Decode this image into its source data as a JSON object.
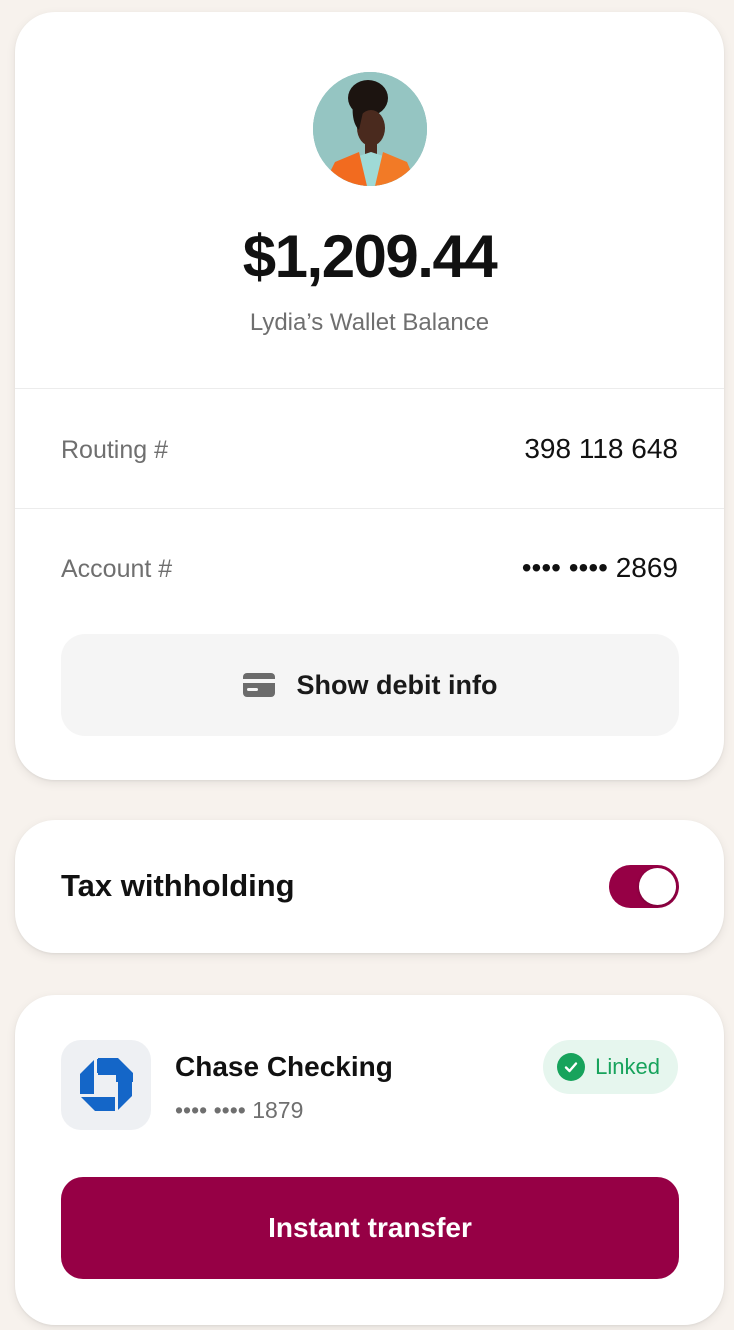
{
  "wallet": {
    "balance": "$1,209.44",
    "balance_label": "Lydia’s Wallet Balance",
    "routing_label": "Routing #",
    "routing_value": "398 118 648",
    "account_label": "Account #",
    "account_value": "•••• •••• 2869",
    "show_debit_label": "Show debit info",
    "show_debit_icon": "credit-card-icon"
  },
  "tax": {
    "label": "Tax withholding",
    "toggle_on": true
  },
  "bank": {
    "logo_icon": "chase-logo-icon",
    "name": "Chase Checking",
    "account": "•••• •••• 1879",
    "status_label": "Linked",
    "status_icon": "check-circle-icon"
  },
  "actions": {
    "transfer_label": "Instant transfer"
  },
  "colors": {
    "accent": "#960045",
    "success": "#17a35c",
    "page_background": "#f7f2ed"
  }
}
